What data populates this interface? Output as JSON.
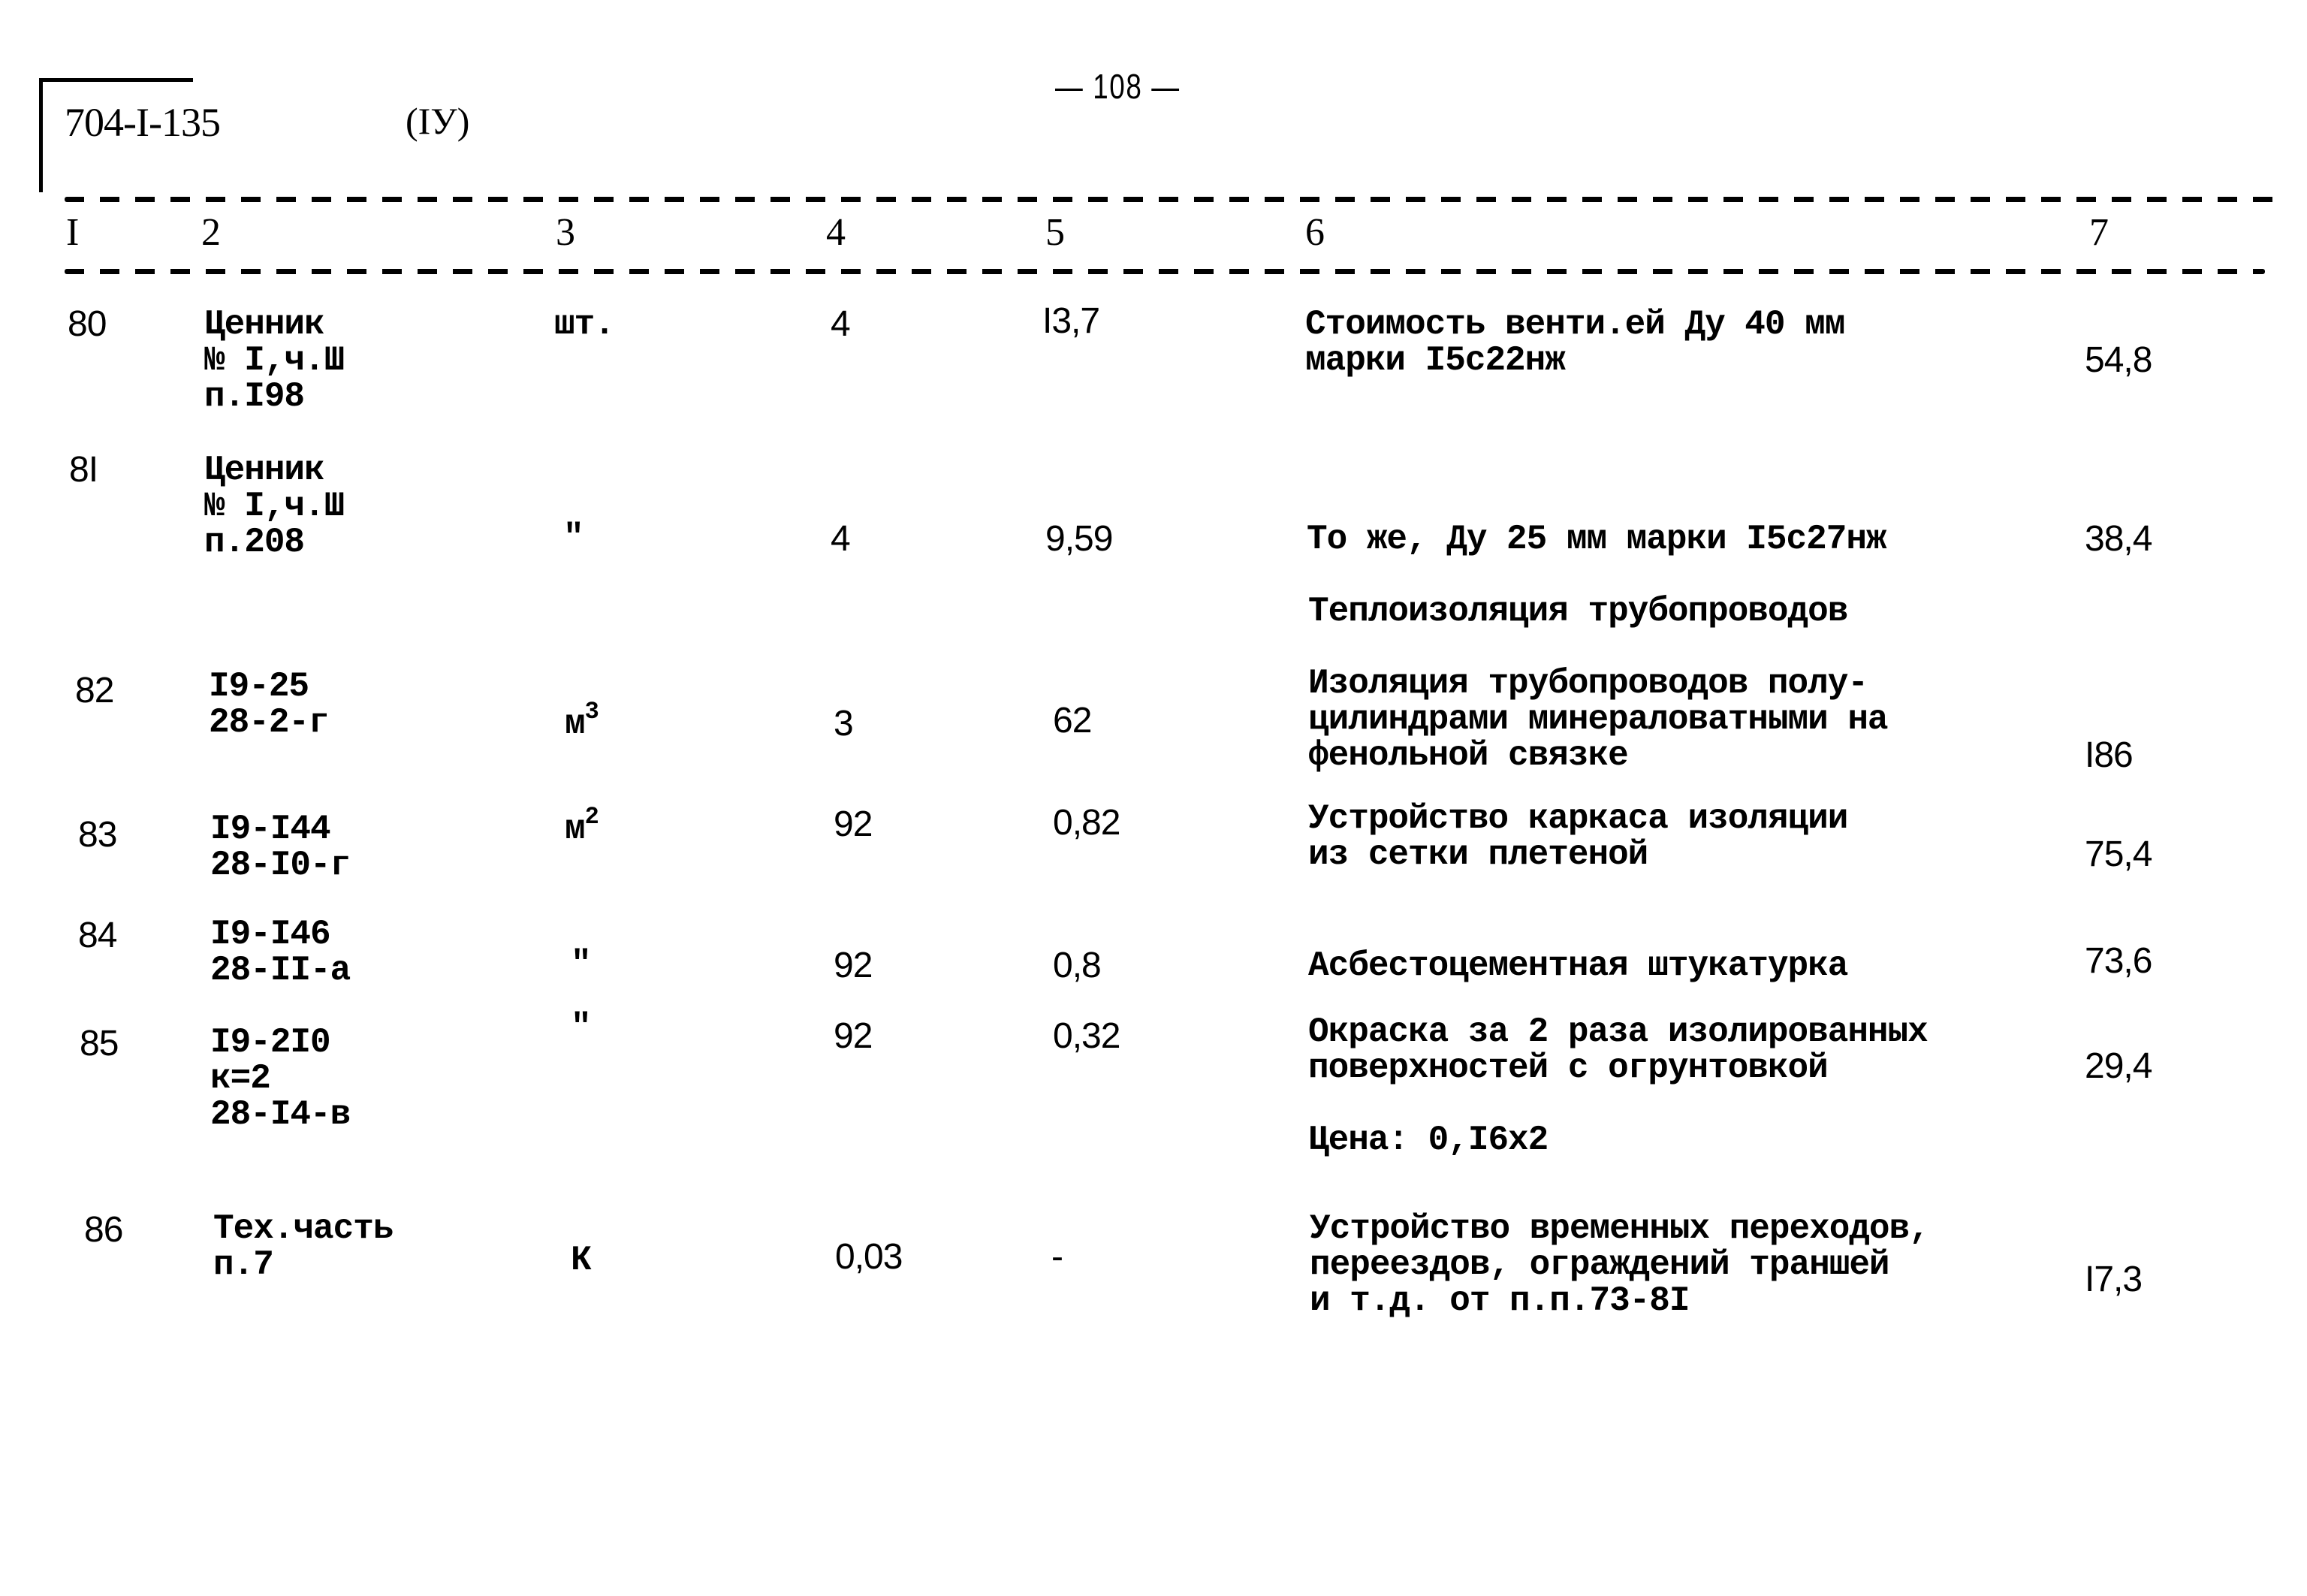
{
  "header": {
    "document_code": "704-I-135",
    "part": "(IУ)",
    "page_number": "— 108 —"
  },
  "columns": [
    "I",
    "2",
    "3",
    "4",
    "5",
    "6",
    "7"
  ],
  "rows": [
    {
      "no": "80",
      "basis": "Ценник\n№ I,ч.Ш\nп.I98",
      "unit": "шт.",
      "quantity": "4",
      "unit_price": "I3,7",
      "description": "Стоимость венти.ей Ду 40 мм\nмарки I5с22нж",
      "total": "54,8"
    },
    {
      "no": "8I",
      "basis": "Ценник\n№ I,ч.Ш\nп.208",
      "unit": "\"",
      "quantity": "4",
      "unit_price": "9,59",
      "description": "То же, Ду 25 мм марки I5с27нж",
      "total": "38,4"
    },
    {
      "section_title": "Теплоизоляция трубопроводов"
    },
    {
      "no": "82",
      "basis": "I9-25\n28-2-г",
      "unit": "м",
      "unit_sup": "3",
      "quantity": "3",
      "unit_price": "62",
      "description": "Изоляция трубопроводов полу-\nцилиндрами минераловатными на\nфенольной связке",
      "total": "I86"
    },
    {
      "no": "83",
      "basis": "I9-I44\n28-I0-г",
      "unit": "м",
      "unit_sup": "2",
      "quantity": "92",
      "unit_price": "0,82",
      "description": "Устройство каркаса изоляции\nиз сетки плетеной",
      "total": "75,4"
    },
    {
      "no": "84",
      "basis": "I9-I46\n28-II-а",
      "unit": "\"",
      "quantity": "92",
      "unit_price": "0,8",
      "description": "Асбестоцементная штукатурка",
      "total": "73,6"
    },
    {
      "no": "85",
      "basis": "I9-2I0\nк=2\n28-I4-в",
      "unit": "\"",
      "quantity": "92",
      "unit_price": "0,32",
      "description": "Окраска за 2 раза изолированных\nповерхностей с огрунтовкой",
      "total": "29,4",
      "note": "Цена: 0,I6x2"
    },
    {
      "no": "86",
      "basis": "Тех.часть\nп.7",
      "unit": "К",
      "quantity": "0,03",
      "unit_price": "-",
      "description": "Устройство временных переходов,\nпереездов, ограждений траншей\nи т.д. от п.п.73-8I",
      "total": "I7,3"
    }
  ]
}
